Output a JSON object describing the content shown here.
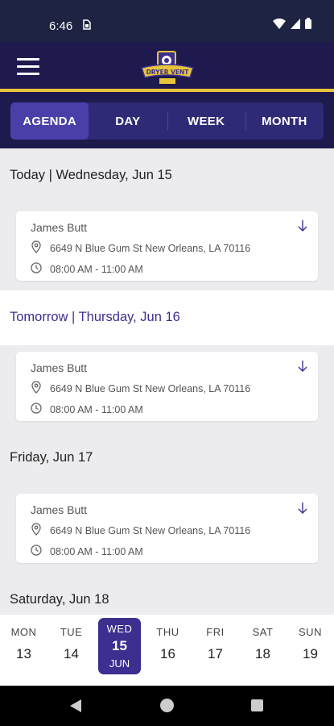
{
  "status_bar": {
    "time": "6:46",
    "sim_icon": "sim-card-icon"
  },
  "header": {
    "menu_icon": "hamburger-menu-icon",
    "logo_text": "DRYER VENT"
  },
  "tabs": [
    {
      "label": "AGENDA",
      "active": true
    },
    {
      "label": "DAY",
      "active": false
    },
    {
      "label": "WEEK",
      "active": false
    },
    {
      "label": "MONTH",
      "active": false
    }
  ],
  "agenda": [
    {
      "header": "Today | Wednesday, Jun 15",
      "event": {
        "name": "James Butt",
        "address": "6649 N Blue Gum St New Orleans, LA 70116",
        "time": "08:00 AM - 11:00 AM"
      }
    },
    {
      "header": "Tomorrow | Thursday, Jun 16",
      "event": {
        "name": "James Butt",
        "address": "6649 N Blue Gum St New Orleans, LA 70116",
        "time": "08:00 AM - 11:00 AM"
      }
    },
    {
      "header": "Friday, Jun 17",
      "event": {
        "name": "James Butt",
        "address": "6649 N Blue Gum St New Orleans, LA 70116",
        "time": "08:00 AM - 11:00 AM"
      }
    },
    {
      "header": "Saturday, Jun 18"
    }
  ],
  "week_strip": [
    {
      "day": "MON",
      "num": "13"
    },
    {
      "day": "TUE",
      "num": "14"
    },
    {
      "day": "WED",
      "num": "15",
      "month": "JUN",
      "selected": true
    },
    {
      "day": "THU",
      "num": "16"
    },
    {
      "day": "FRI",
      "num": "17"
    },
    {
      "day": "SAT",
      "num": "18"
    },
    {
      "day": "SUN",
      "num": "19"
    }
  ],
  "colors": {
    "header_bg": "#1e1a4e",
    "accent": "#3b2f8f",
    "gold": "#e8c43a"
  }
}
